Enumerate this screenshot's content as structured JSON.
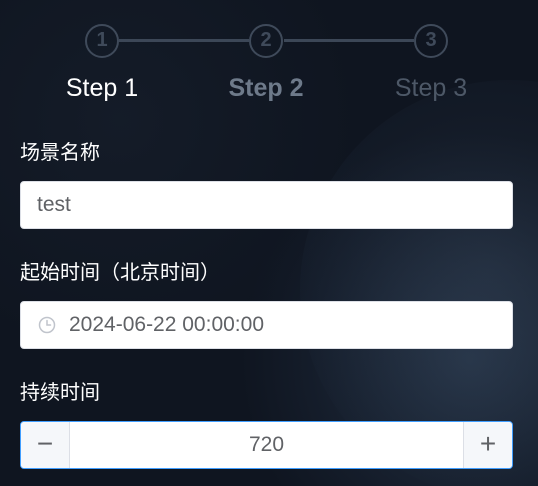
{
  "steps": [
    {
      "number": "1",
      "label": "Step 1",
      "state": "active"
    },
    {
      "number": "2",
      "label": "Step 2",
      "state": "upcoming"
    },
    {
      "number": "3",
      "label": "Step 3",
      "state": "upcoming"
    }
  ],
  "form": {
    "scene_name": {
      "label": "场景名称",
      "value": "test"
    },
    "start_time": {
      "label": "起始时间（北京时间）",
      "value": "2024-06-22 00:00:00",
      "icon": "clock-icon"
    },
    "duration": {
      "label": "持续时间",
      "value": "720",
      "decrement": "−",
      "increment": "+"
    }
  },
  "colors": {
    "background": "#0f1520",
    "step_inactive": "#3f4a5a",
    "accent": "#409eff",
    "input_text": "#606266"
  }
}
